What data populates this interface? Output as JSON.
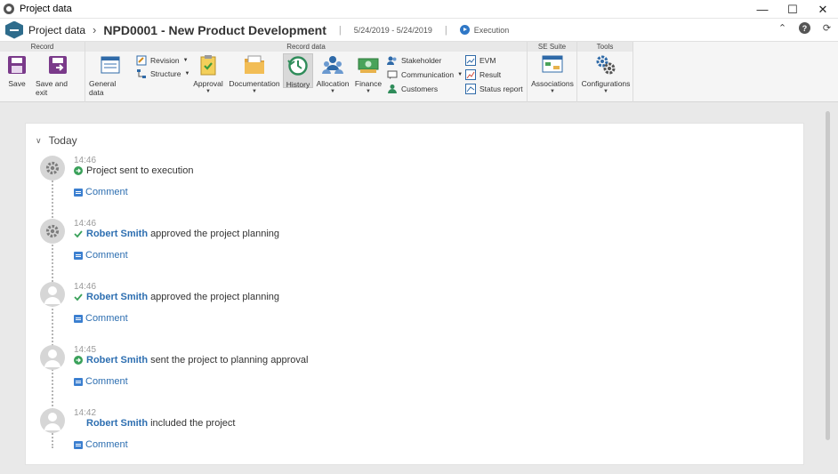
{
  "window": {
    "title": "Project data",
    "minimize": "—",
    "maximize": "☐",
    "close": "✕"
  },
  "header": {
    "section": "Project data",
    "record": "NPD0001 - New Product Development",
    "dates": "5/24/2019 - 5/24/2019",
    "status": "Execution"
  },
  "ribbon": {
    "groups": {
      "record": "Record",
      "record_data": "Record data",
      "se_suite": "SE Suite",
      "tools": "Tools"
    },
    "buttons": {
      "save": "Save",
      "save_exit": "Save and exit",
      "general_data": "General data",
      "revision": "Revision",
      "structure": "Structure",
      "approval": "Approval",
      "documentation": "Documentation",
      "history": "History",
      "allocation": "Allocation",
      "finance": "Finance",
      "stakeholder": "Stakeholder",
      "communication": "Communication",
      "customers": "Customers",
      "evm": "EVM",
      "result": "Result",
      "status_report": "Status report",
      "associations": "Associations",
      "configurations": "Configurations"
    }
  },
  "timeline": {
    "group_label": "Today",
    "comment_label": "Comment",
    "entries": [
      {
        "time": "14:46",
        "avatar": "gear-icon",
        "status": "play-icon",
        "user": "",
        "text": "Project sent to execution"
      },
      {
        "time": "14:46",
        "avatar": "gear-icon",
        "status": "check-icon",
        "user": "Robert Smith",
        "text": "approved the project planning"
      },
      {
        "time": "14:46",
        "avatar": "user-icon",
        "status": "check-icon",
        "user": "Robert Smith",
        "text": "approved the project planning"
      },
      {
        "time": "14:45",
        "avatar": "user-icon",
        "status": "play-icon",
        "user": "Robert Smith",
        "text": "sent the project to planning approval"
      },
      {
        "time": "14:42",
        "avatar": "user-icon",
        "status": "",
        "user": "Robert Smith",
        "text": "included the project"
      }
    ]
  },
  "colors": {
    "accent": "#2e6fb1",
    "ribbon_bg": "#f5f5f5",
    "content_bg": "#e9e9e9"
  }
}
